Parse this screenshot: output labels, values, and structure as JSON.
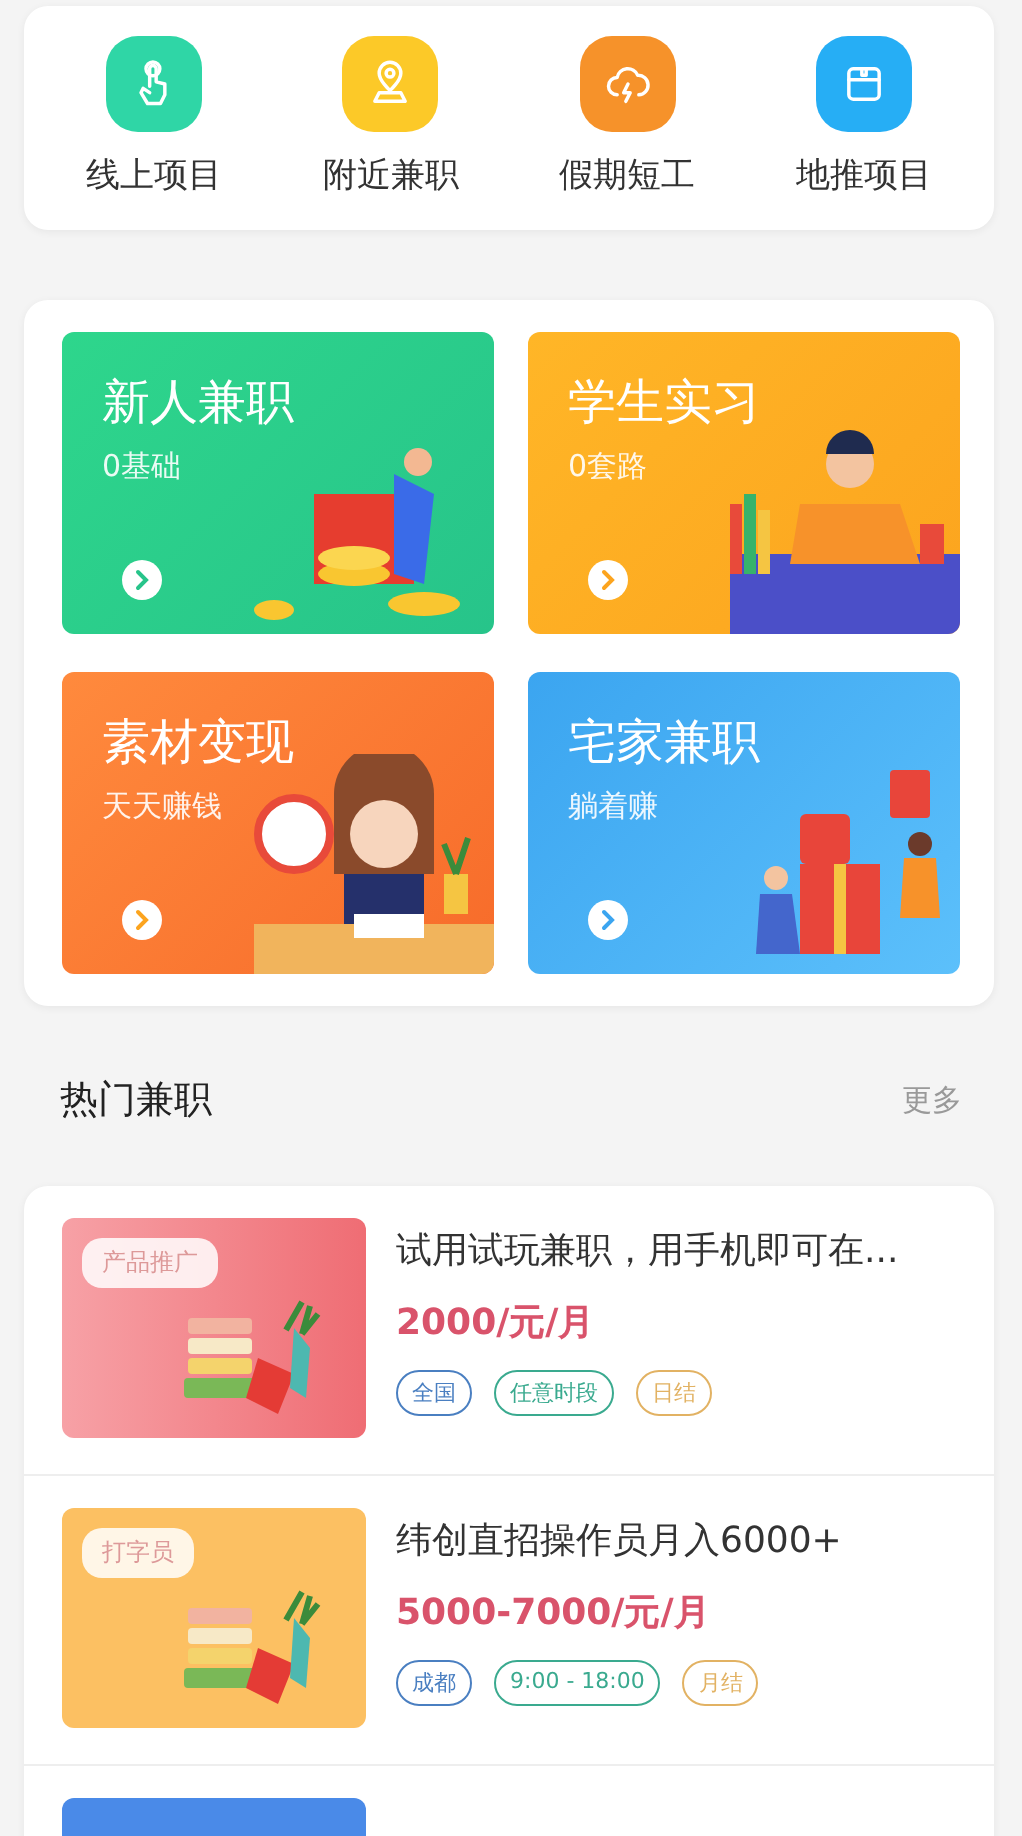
{
  "categories": [
    {
      "label": "线上项目",
      "kind": "hand",
      "color": "#2fd6a6"
    },
    {
      "label": "附近兼职",
      "kind": "pin",
      "color": "#fcc928"
    },
    {
      "label": "假期短工",
      "kind": "cloud",
      "color": "#f6922a"
    },
    {
      "label": "地推项目",
      "kind": "bag",
      "color": "#26aef5"
    }
  ],
  "banners": [
    {
      "title": "新人兼职",
      "subtitle": "0基础",
      "kind": "newbie"
    },
    {
      "title": "学生实习",
      "subtitle": "0套路",
      "kind": "student"
    },
    {
      "title": "素材变现",
      "subtitle": "天天赚钱",
      "kind": "material"
    },
    {
      "title": "宅家兼职",
      "subtitle": "躺着赚",
      "kind": "home"
    }
  ],
  "hot": {
    "title": "热门兼职",
    "more": "更多"
  },
  "jobs": [
    {
      "kind": "pink",
      "tag": "产品推广",
      "title": "试用试玩兼职，用手机即可在...",
      "salary": "2000/元/月",
      "labels": [
        {
          "text": "全国",
          "color": "#4a7fc1"
        },
        {
          "text": "任意时段",
          "color": "#3aaa8f"
        },
        {
          "text": "日结",
          "color": "#e2b263"
        }
      ]
    },
    {
      "kind": "yellow",
      "tag": "打字员",
      "title": "纬创直招操作员月入6000+",
      "salary": "5000-7000/元/月",
      "labels": [
        {
          "text": "成都",
          "color": "#4a7fc1"
        },
        {
          "text": "9:00 - 18:00",
          "color": "#3aaa8f"
        },
        {
          "text": "月结",
          "color": "#e2b263"
        }
      ]
    },
    {
      "kind": "blue"
    }
  ]
}
